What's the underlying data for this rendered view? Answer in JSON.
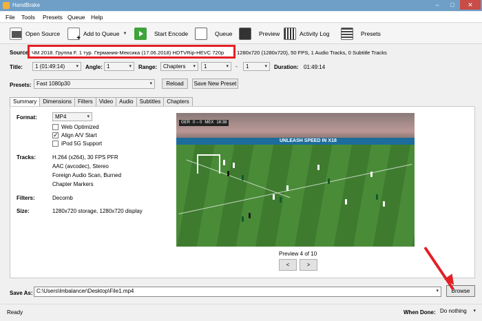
{
  "window": {
    "title": "HandBrake",
    "min": "–",
    "max": "□",
    "close": "✕"
  },
  "menu": [
    "File",
    "Tools",
    "Presets",
    "Queue",
    "Help"
  ],
  "toolbar": {
    "open_source": "Open Source",
    "add_to_queue": "Add to Queue",
    "start_encode": "Start Encode",
    "queue": "Queue",
    "preview": "Preview",
    "activity_log": "Activity Log",
    "presets": "Presets"
  },
  "source": {
    "label": "Source:",
    "name": "ЧМ 2018. Группа F. 1 тур. Германия-Мексика  (17.06.2018) HDTVRip-HEVC 720p",
    "info": "1280x720 (1280x720), 50 FPS, 1 Audio Tracks, 0 Subtitle Tracks"
  },
  "title_row": {
    "title_label": "Title:",
    "title_value": "1 (01:49:14)",
    "angle_label": "Angle:",
    "angle_value": "1",
    "range_label": "Range:",
    "range_value": "Chapters",
    "range_start": "1",
    "range_sep": "-",
    "range_end": "1",
    "duration_label": "Duration:",
    "duration_value": "01:49:14"
  },
  "presets_row": {
    "label": "Presets:",
    "value": "Fast 1080p30",
    "reload": "Reload",
    "save_new": "Save New Preset"
  },
  "tabs": [
    "Summary",
    "Dimensions",
    "Filters",
    "Video",
    "Audio",
    "Subtitles",
    "Chapters"
  ],
  "summary": {
    "format_label": "Format:",
    "format_value": "MP4",
    "web_optimized": "Web Optimized",
    "web_optimized_checked": false,
    "align_av": "Align A/V Start",
    "align_av_checked": true,
    "ipod": "iPod 5G Support",
    "ipod_checked": false,
    "tracks_label": "Tracks:",
    "tracks": [
      "H.264 (x264), 30 FPS PFR",
      "AAC (avcodec), Stereo",
      "Foreign Audio Scan, Burned",
      "Chapter Markers"
    ],
    "filters_label": "Filters:",
    "filters_value": "Decomb",
    "size_label": "Size:",
    "size_value": "1280x720 storage, 1280x720 display"
  },
  "preview_frame": {
    "score_home": "GER",
    "score": "0 – 0",
    "score_away": "MEX",
    "clock": "18:38",
    "board": "UNLEASH SPEED IN X18"
  },
  "preview": {
    "caption": "Preview 4 of 10",
    "prev": "<",
    "next": ">"
  },
  "save_as": {
    "label": "Save As:",
    "path": "C:\\Users\\lmbalancer\\Desktop\\File1.mp4",
    "browse": "Browse"
  },
  "status": {
    "text": "Ready",
    "when_done_label": "When Done:",
    "when_done_value": "Do nothing"
  },
  "colors": {
    "highlight": "#e32024",
    "titlebar": "#6f9fc7"
  }
}
